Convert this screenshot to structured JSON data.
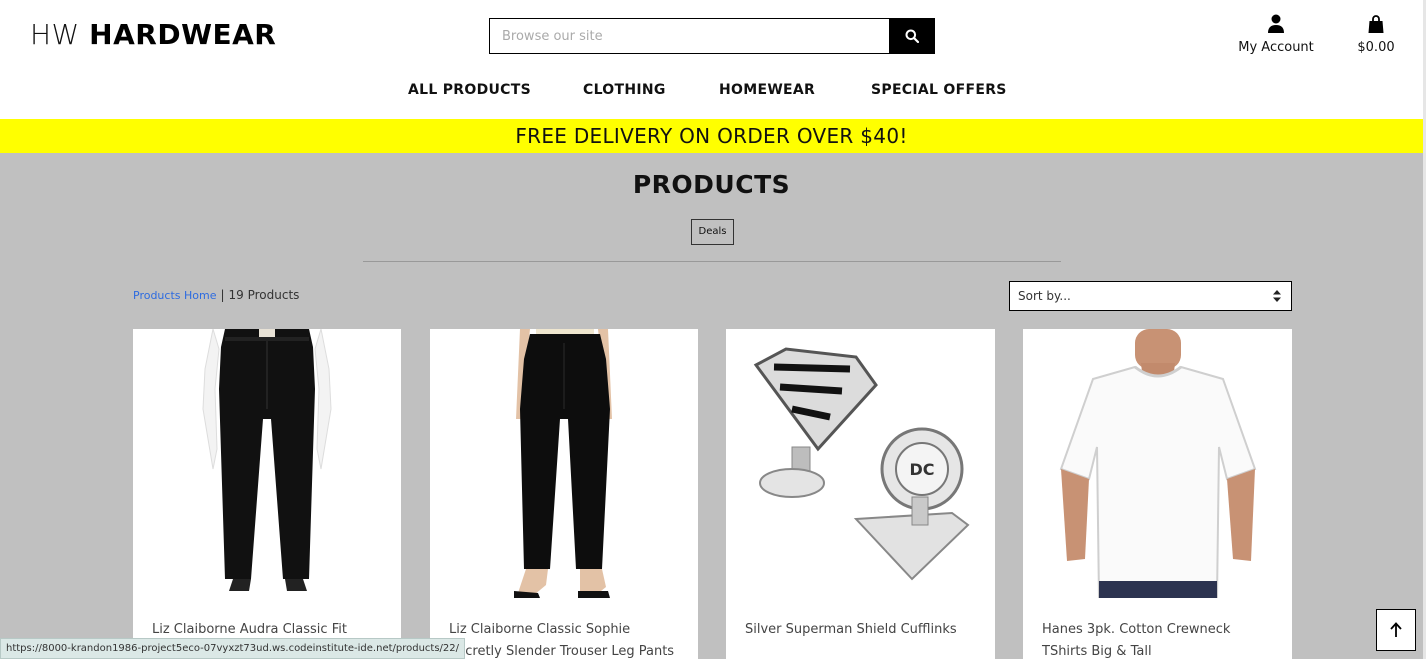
{
  "brand": {
    "prefix": "HW",
    "name": "HARDWEAR"
  },
  "search": {
    "placeholder": "Browse our site",
    "value": "",
    "button_icon": "search-icon"
  },
  "account": {
    "label": "My Account",
    "icon": "user-icon"
  },
  "bag": {
    "total": "$0.00",
    "icon": "shopping-bag-icon"
  },
  "nav": {
    "items": [
      "ALL PRODUCTS",
      "CLOTHING",
      "HOMEWEAR",
      "SPECIAL OFFERS"
    ]
  },
  "banner": {
    "text": "FREE DELIVERY ON ORDER OVER $40!",
    "color": "#ffff00"
  },
  "page": {
    "title": "PRODUCTS",
    "category_badge": "Deals"
  },
  "breadcrumb": {
    "home": "Products Home",
    "separator": "|",
    "count": "19 Products"
  },
  "sort": {
    "selected": "Sort by..."
  },
  "products": [
    {
      "name": "Liz Claiborne Audra Classic Fit",
      "image": "black-trousers"
    },
    {
      "name": "Liz Claiborne Classic Sophie Secretly Slender Trouser Leg Pants - Plus",
      "image": "black-trousers-heels"
    },
    {
      "name": "Silver Superman Shield Cufflinks",
      "image": "superman-cufflinks"
    },
    {
      "name": "Hanes 3pk. Cotton Crewneck TShirts Big & Tall",
      "image": "white-tshirt"
    }
  ],
  "status_bar": {
    "url": "https://8000-krandon1986-project5eco-07vyxzt73ud.ws.codeinstitute-ide.net/products/22/"
  },
  "back_to_top": {
    "icon": "arrow-up-icon"
  },
  "colors": {
    "background": "#c0c0c0",
    "banner": "#ffff00",
    "link": "#2d6be0",
    "header": "#ffffff"
  }
}
